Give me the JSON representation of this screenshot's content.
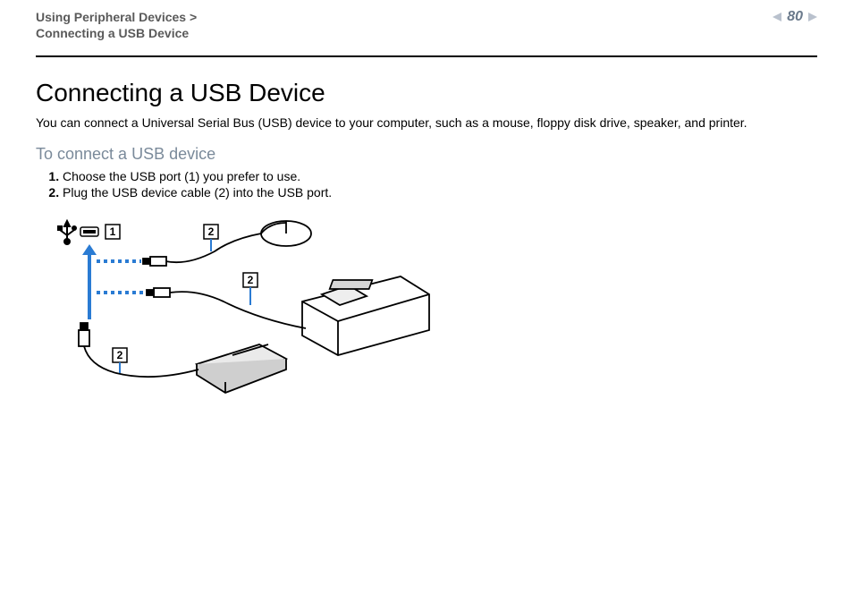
{
  "header": {
    "breadcrumb_line1": "Using Peripheral Devices >",
    "breadcrumb_line2": "Connecting a USB Device",
    "page_number": "80"
  },
  "content": {
    "title": "Connecting a USB Device",
    "lead": "You can connect a Universal Serial Bus (USB) device to your computer, such as a mouse, floppy disk drive, speaker, and printer.",
    "subhead": "To connect a USB device",
    "steps": {
      "s1": "Choose the USB port (1) you prefer to use.",
      "s2": "Plug the USB device cable (2) into the USB port."
    }
  },
  "figure": {
    "label_1": "1",
    "label_2a": "2",
    "label_2b": "2",
    "label_2c": "2"
  }
}
